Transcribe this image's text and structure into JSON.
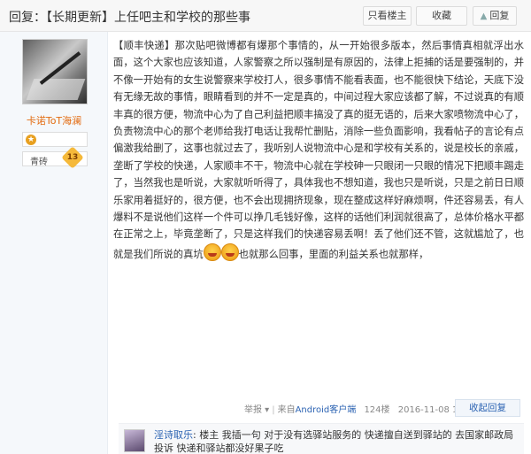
{
  "header": {
    "reply_prefix": "回复：",
    "title": "【长期更新】上任吧主和学校的那些事",
    "only_op_label": "只看楼主",
    "favorite_label": "收藏",
    "reply_label": "回复",
    "reply_icon": "thumb-icon"
  },
  "user": {
    "name": "卡诺ToT海澜",
    "badge_icon": "medal-icon",
    "level_name": "青砖",
    "level_num": "13"
  },
  "post": {
    "body_1": "【顺丰快递】那次贴吧微博都有爆那个事情的，从一开始很多版本，然后事情真相就浮出水面，这个大家也应该知道，人家警察之所以强制是有原因的，法律上拒捕的话是要强制的，并不像一开始有的女生说警察来学校打人，很多事情不能看表面，也不能很快下结论，天底下没有无缘无故的事情，眼睛看到的并不一定是真的，中间过程大家应该都了解，不过说真的有顺丰真的很方便，物流中心为了自己利益把顺丰搞没了真的挺无语的，后来大家喷物流中心了，负责物流中心的那个老师给我打电话让我帮忙删贴，消除一些负面影响，我看帖子的言论有点偏激我给删了，这事也就过去了，我听别人说物流中心是和学校有关系的，说是校长的亲戚，垄断了学校的快递，人家顺丰不干，物流中心就在学校砷一只眼闭一只眼的情况下把顺丰踢走了，当然我也是听说，大家就听听得了，具体我也不想知道，我也只是听说，只是之前日日顺乐家用着挺好的，很方便，也不会出现拥挤现象，现在整成这样好麻烦啊，件还容易丢，有人爆料不是说他们这样一个件可以挣几毛钱好像，这样的话他们利润就很高了，总体价格水平都在正常之上，毕竟垄断了，只是这样我们的快递容易丢啊！丢了他们还不管，这就尴尬了，也就是我们所说的真坑",
    "emoji_1": "laugh-emoji",
    "emoji_2": "laugh-emoji",
    "body_2": "也就那么回事，里面的利益关系也就那样，"
  },
  "meta": {
    "report": "举报",
    "report_icon": "caret-down-icon",
    "source_prefix": "来自",
    "source_link": "Android客户端",
    "floor": "124楼",
    "time": "2016-11-08 11:21",
    "collapse_reply": "收起回复"
  },
  "subreply": {
    "author": "淫诗取乐",
    "text": ": 楼主 我插一句 对于没有选驿站服务的 快递擅自送到驿站的 去国家邮政局投诉 快递和驿站都没好果子吃"
  },
  "colors": {
    "link": "#2d64b3",
    "username": "#e36b10",
    "level_badge": "#f5b93a"
  }
}
